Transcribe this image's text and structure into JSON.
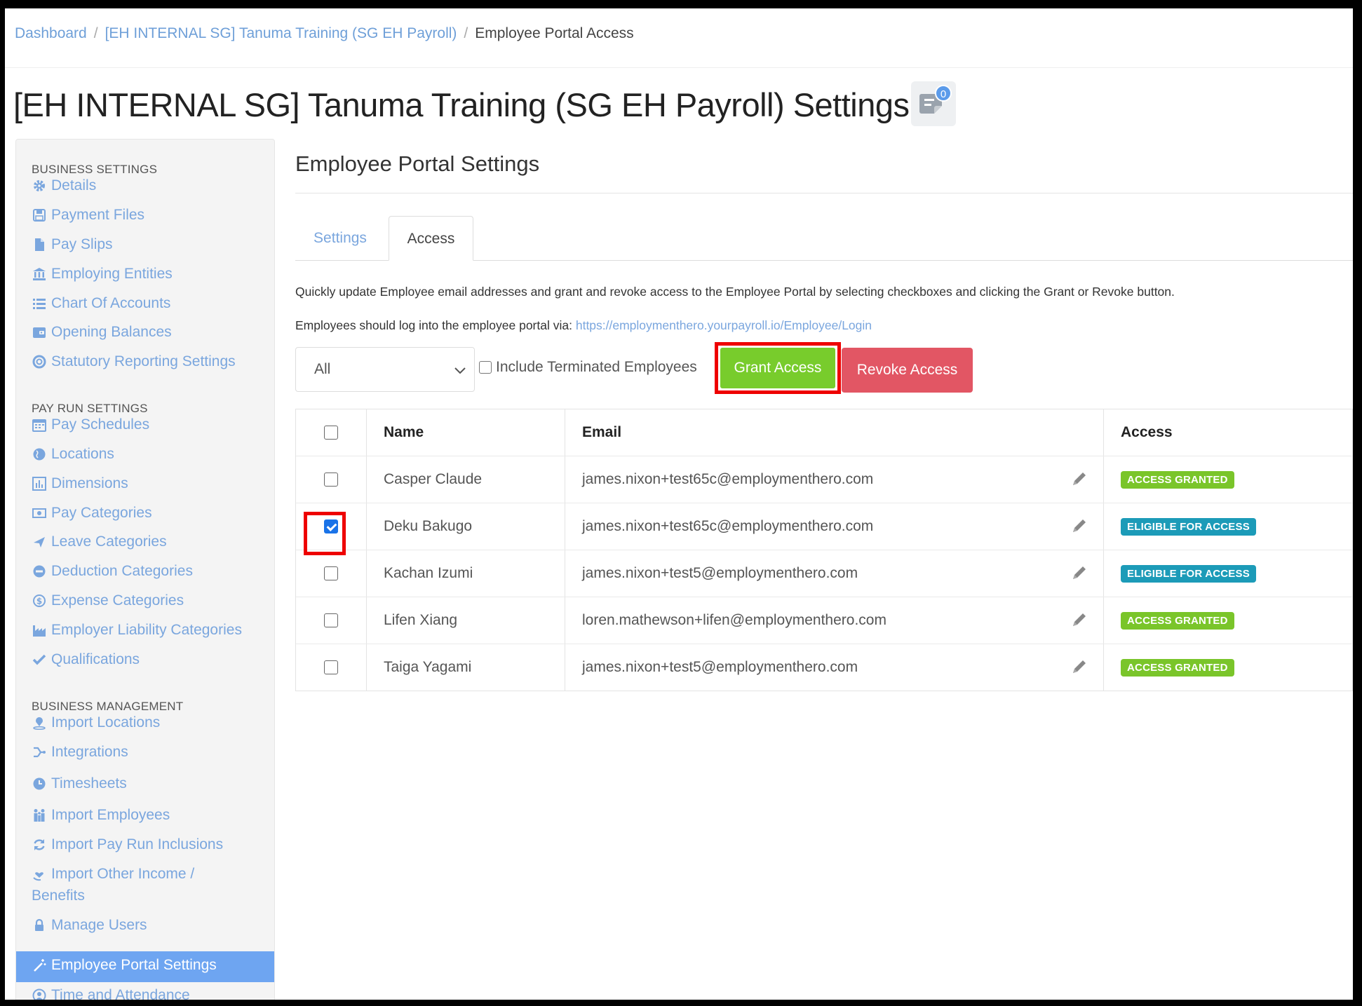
{
  "breadcrumb": {
    "items": [
      "Dashboard",
      "[EH INTERNAL SG] Tanuma Training (SG EH Payroll)",
      "Employee Portal Access"
    ],
    "separator": "/"
  },
  "page_title": "[EH INTERNAL SG] Tanuma Training (SG EH Payroll) Settings",
  "notification_count": "0",
  "sidebar": {
    "business_settings": {
      "heading": "BUSINESS SETTINGS",
      "items": [
        {
          "label": "Details",
          "icon": "gear-icon"
        },
        {
          "label": "Payment Files",
          "icon": "floppy-icon"
        },
        {
          "label": "Pay Slips",
          "icon": "file-icon"
        },
        {
          "label": "Employing Entities",
          "icon": "bank-icon"
        },
        {
          "label": "Chart Of Accounts",
          "icon": "list-icon"
        },
        {
          "label": "Opening Balances",
          "icon": "wallet-icon"
        },
        {
          "label": "Statutory Reporting Settings",
          "icon": "lifebuoy-icon"
        }
      ]
    },
    "pay_run_settings": {
      "heading": "PAY RUN SETTINGS",
      "items": [
        {
          "label": "Pay Schedules",
          "icon": "calendar-icon"
        },
        {
          "label": "Locations",
          "icon": "globe-icon"
        },
        {
          "label": "Dimensions",
          "icon": "bar-chart-icon"
        },
        {
          "label": "Pay Categories",
          "icon": "money-icon"
        },
        {
          "label": "Leave Categories",
          "icon": "plane-icon"
        },
        {
          "label": "Deduction Categories",
          "icon": "minus-circle-icon"
        },
        {
          "label": "Expense Categories",
          "icon": "dollar-circle-icon"
        },
        {
          "label": "Employer Liability Categories",
          "icon": "factory-icon"
        },
        {
          "label": "Qualifications",
          "icon": "check-icon"
        }
      ]
    },
    "business_management": {
      "heading": "BUSINESS MANAGEMENT",
      "items": [
        {
          "label": "Import Locations",
          "icon": "map-pin-icon"
        },
        {
          "label": "Integrations",
          "icon": "integrations-icon"
        },
        {
          "label": "Timesheets",
          "icon": "clock-icon"
        },
        {
          "label": "Import Employees",
          "icon": "people-icon"
        },
        {
          "label": "Import Pay Run Inclusions",
          "icon": "refresh-icon"
        },
        {
          "label": "Import Other Income /",
          "label2": "Benefits",
          "icon": "hand-heart-icon"
        },
        {
          "label": "Manage Users",
          "icon": "lock-icon"
        },
        {
          "label": "Employee Portal Settings",
          "icon": "magic-wand-icon",
          "active": true
        },
        {
          "label": "Time and Attendance",
          "icon": "user-clock-icon"
        }
      ]
    }
  },
  "main": {
    "title": "Employee Portal Settings",
    "tabs": [
      {
        "label": "Settings",
        "active": false
      },
      {
        "label": "Access",
        "active": true
      }
    ],
    "description": "Quickly update Employee email addresses and grant and revoke access to the Employee Portal by selecting checkboxes and clicking the Grant or Revoke button.",
    "login_prefix": "Employees should log into the employee portal via:",
    "login_url": "https://employmenthero.yourpayroll.io/Employee/Login",
    "filter_select": "All",
    "include_terminated_label": "Include Terminated Employees",
    "grant_label": "Grant Access",
    "revoke_label": "Revoke Access"
  },
  "table": {
    "headers": {
      "name": "Name",
      "email": "Email",
      "access": "Access"
    },
    "rows": [
      {
        "name": "Casper Claude",
        "email": "james.nixon+test65c@employmenthero.com",
        "access": "ACCESS GRANTED",
        "status": "granted",
        "checked": false
      },
      {
        "name": "Deku Bakugo",
        "email": "james.nixon+test65c@employmenthero.com",
        "access": "ELIGIBLE FOR ACCESS",
        "status": "eligible",
        "checked": true
      },
      {
        "name": "Kachan Izumi",
        "email": "james.nixon+test5@employmenthero.com",
        "access": "ELIGIBLE FOR ACCESS",
        "status": "eligible",
        "checked": false
      },
      {
        "name": "Lifen Xiang",
        "email": "loren.mathewson+lifen@employmenthero.com",
        "access": "ACCESS GRANTED",
        "status": "granted",
        "checked": false
      },
      {
        "name": "Taiga Yagami",
        "email": "james.nixon+test5@employmenthero.com",
        "access": "ACCESS GRANTED",
        "status": "granted",
        "checked": false
      }
    ]
  },
  "colors": {
    "link": "#6e9fd8",
    "grant": "#78cc2c",
    "revoke": "#e25664",
    "eligible": "#1c9bb8",
    "highlight": "#e00000",
    "active_sidebar": "#6ea5f1"
  }
}
